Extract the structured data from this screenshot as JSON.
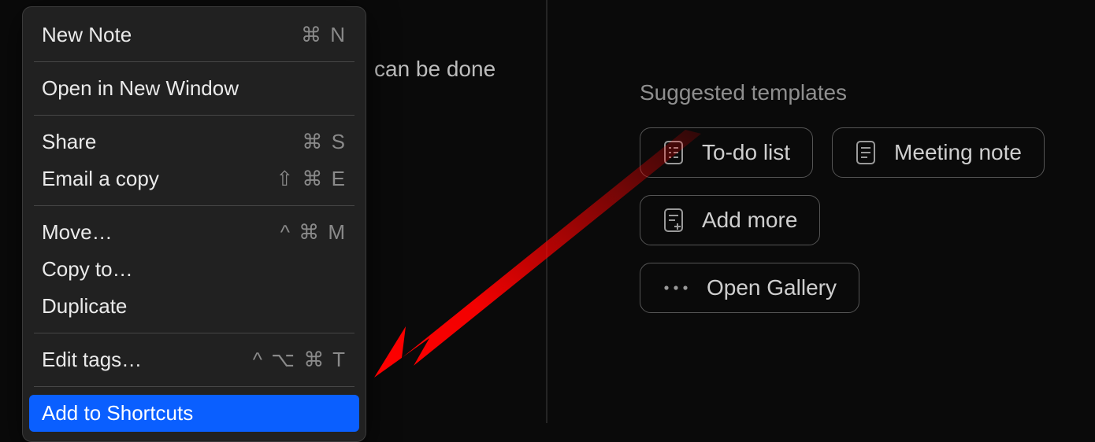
{
  "background": {
    "text_fragment": "can be done"
  },
  "context_menu": {
    "groups": [
      [
        {
          "label": "New Note",
          "shortcut": "⌘ N"
        }
      ],
      [
        {
          "label": "Open in New Window",
          "shortcut": ""
        }
      ],
      [
        {
          "label": "Share",
          "shortcut": "⌘ S"
        },
        {
          "label": "Email a copy",
          "shortcut": "⇧ ⌘ E"
        }
      ],
      [
        {
          "label": "Move…",
          "shortcut": "^ ⌘ M"
        },
        {
          "label": "Copy to…",
          "shortcut": ""
        },
        {
          "label": "Duplicate",
          "shortcut": ""
        }
      ],
      [
        {
          "label": "Edit tags…",
          "shortcut": "^ ⌥ ⌘ T"
        }
      ],
      [
        {
          "label": "Add to Shortcuts",
          "shortcut": "",
          "highlighted": true
        }
      ]
    ]
  },
  "templates": {
    "heading": "Suggested templates",
    "buttons": {
      "todo": "To-do list",
      "meeting_note": "Meeting note",
      "add_more": "Add more",
      "open_gallery": "Open Gallery"
    }
  }
}
